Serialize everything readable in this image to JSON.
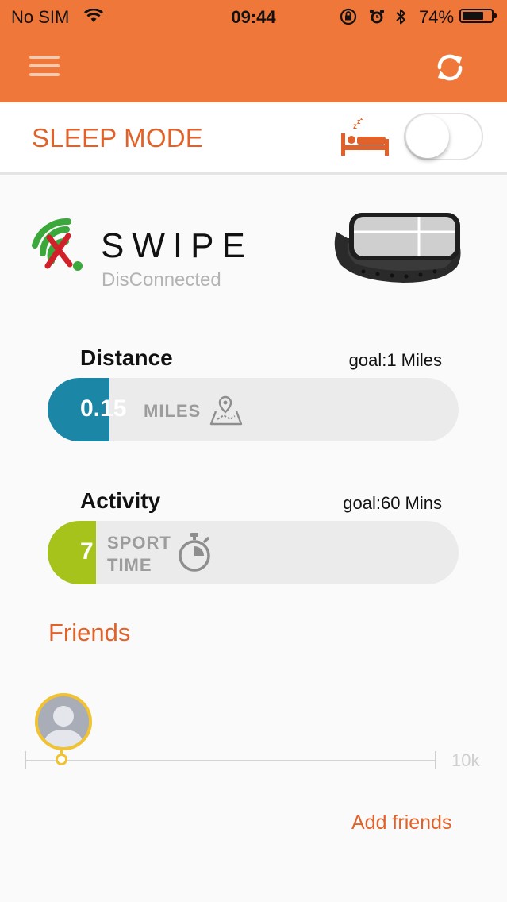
{
  "status_bar": {
    "carrier": "No SIM",
    "time": "09:44",
    "battery_percent": "74%",
    "battery_level": 0.74
  },
  "nav": {
    "menu_icon": "hamburger-icon",
    "sync_icon": "sync-icon"
  },
  "sleep_mode": {
    "label": "SLEEP MODE",
    "icon": "sleep-bed-icon",
    "enabled": false
  },
  "device": {
    "name": "SWIPE",
    "status": "DisConnected",
    "status_icon": "wifi-disconnected-icon"
  },
  "distance": {
    "title": "Distance",
    "goal": "goal:1 Miles",
    "value": "0.15",
    "unit": "MILES",
    "icon": "map-pin-icon",
    "progress": 0.15,
    "color": "#1b86a5"
  },
  "activity": {
    "title": "Activity",
    "goal": "goal:60 Mins",
    "value": "7",
    "unit_line1": "SPORT",
    "unit_line2": "TIME",
    "icon": "stopwatch-icon",
    "progress": 0.117,
    "color": "#a5c31a"
  },
  "friends": {
    "title": "Friends",
    "scale_max": "10k",
    "add_label": "Add friends"
  },
  "colors": {
    "accent": "#ef773a",
    "accent_text": "#e0622a"
  }
}
